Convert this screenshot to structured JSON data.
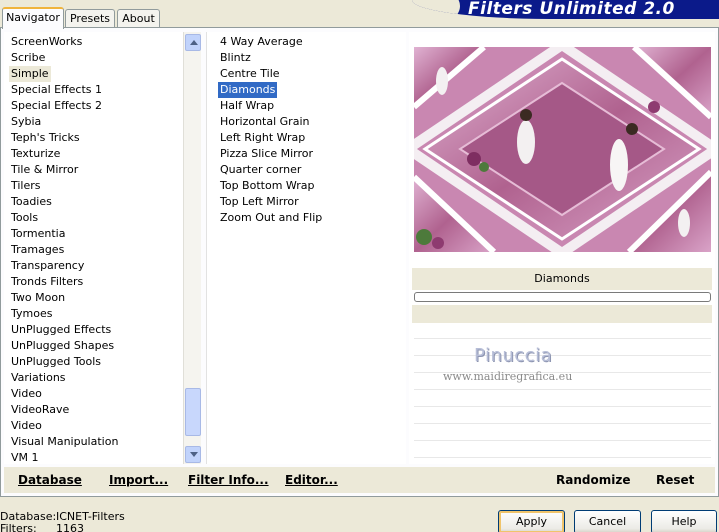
{
  "tabs": [
    {
      "label": "Navigator",
      "active": true
    },
    {
      "label": "Presets",
      "active": false
    },
    {
      "label": "About",
      "active": false
    }
  ],
  "header": {
    "title": "Filters Unlimited 2.0"
  },
  "categories": [
    "ScreenWorks",
    "Scribe",
    "Simple",
    "Special Effects 1",
    "Special Effects 2",
    "Sybia",
    "Teph's Tricks",
    "Texturize",
    "Tile & Mirror",
    "Tilers",
    "Toadies",
    "Tools",
    "Tormentia",
    "Tramages",
    "Transparency",
    "Tronds Filters",
    "Two Moon",
    "Tymoes",
    "UnPlugged Effects",
    "UnPlugged Shapes",
    "UnPlugged Tools",
    "Variations",
    "Video",
    "VideoRave",
    "Video",
    "Visual Manipulation",
    "VM 1"
  ],
  "selected_category": "Simple",
  "filters": [
    "4 Way Average",
    "Blintz",
    "Centre Tile",
    "Diamonds",
    "Half Wrap",
    "Horizontal Grain",
    "Left Right Wrap",
    "Pizza Slice Mirror",
    "Quarter corner",
    "Top Bottom Wrap",
    "Top Left Mirror",
    "Zoom Out and Flip"
  ],
  "selected_filter": "Diamonds",
  "preview": {
    "filter_name": "Diamonds"
  },
  "watermark": {
    "name": "Pinuccia",
    "url": "www.maidiregrafica.eu"
  },
  "toolbar": {
    "database": "Database",
    "import": "Import...",
    "filter_info": "Filter Info...",
    "editor": "Editor...",
    "randomize": "Randomize",
    "reset": "Reset"
  },
  "status": {
    "database_label": "Database:",
    "database_value": "ICNET-Filters",
    "filters_label": "Filters:",
    "filters_value": "1163"
  },
  "buttons": {
    "apply": "Apply",
    "cancel": "Cancel",
    "help": "Help"
  },
  "colors": {
    "selection": "#316ac5",
    "header_bg": "#0b1a8a",
    "panel_bg": "#ece9d8"
  },
  "icons": {
    "scroll_up": "chevron-up-icon",
    "scroll_down": "chevron-down-icon"
  }
}
